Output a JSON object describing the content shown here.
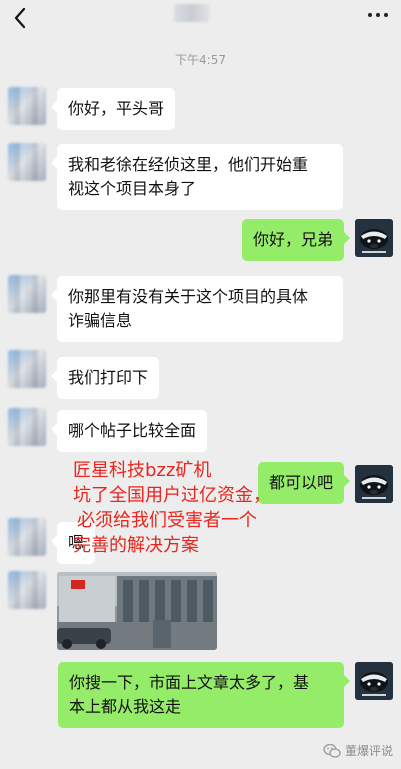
{
  "header": {
    "back_icon": "chevron-left-icon",
    "more_icon": "more-dots-icon"
  },
  "timestamp": "下午4:57",
  "messages": [
    {
      "side": "left",
      "text_lines": [
        "你好，平头哥"
      ]
    },
    {
      "side": "left",
      "text_lines": [
        "我和老徐在经侦这里，他们开始重",
        "视这个项目本身了"
      ]
    },
    {
      "side": "right",
      "text_lines": [
        "你好，兄弟"
      ]
    },
    {
      "side": "left",
      "text_lines": [
        "你那里有没有关于这个项目的具体",
        "诈骗信息"
      ]
    },
    {
      "side": "left",
      "text_lines": [
        "我们打印下"
      ]
    },
    {
      "side": "left",
      "text_lines": [
        "哪个帖子比较全面"
      ]
    },
    {
      "side": "right",
      "text_lines": [
        "都可以吧"
      ]
    },
    {
      "side": "left",
      "text_lines": [
        "嗯"
      ]
    },
    {
      "side": "left",
      "type": "image",
      "description_icon": "photo-thumbnail"
    },
    {
      "side": "right",
      "text_lines": [
        "你搜一下，市面上文章太多了，基",
        "本上都从我这走"
      ]
    }
  ],
  "overlay_text": {
    "lines": [
      "匠星科技bzz矿机",
      "坑了全国用户过亿资金，",
      "必须给我们受害者一个",
      "完善的解决方案"
    ],
    "color": "#e8261e"
  },
  "watermark": {
    "icon": "wechat-official-account-icon",
    "text": "董爆评说"
  },
  "colors": {
    "background": "#ededed",
    "bubble_left": "#ffffff",
    "bubble_right": "#95ec69"
  }
}
